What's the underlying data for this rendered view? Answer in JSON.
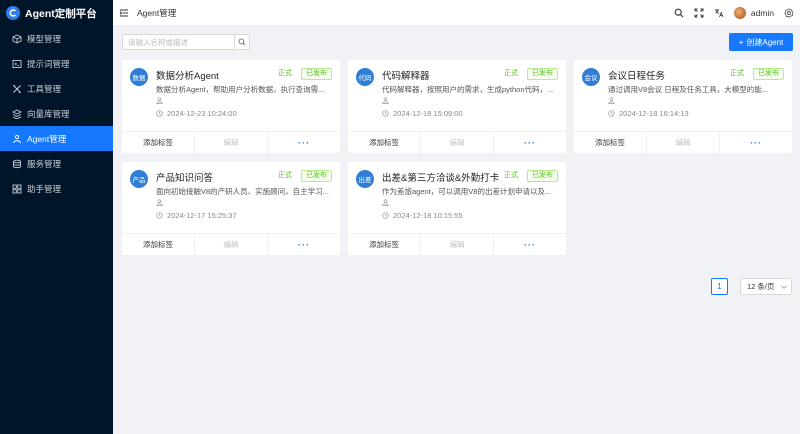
{
  "app": {
    "title": "Agent定制平台"
  },
  "sidebar": {
    "items": [
      {
        "label": "模型管理",
        "icon": "model-icon"
      },
      {
        "label": "提示词管理",
        "icon": "prompt-icon"
      },
      {
        "label": "工具管理",
        "icon": "tools-icon"
      },
      {
        "label": "向量库管理",
        "icon": "vector-icon"
      },
      {
        "label": "Agent管理",
        "icon": "agent-icon",
        "active": true
      },
      {
        "label": "服务管理",
        "icon": "database-icon"
      },
      {
        "label": "助手管理",
        "icon": "grid-icon"
      }
    ]
  },
  "header": {
    "breadcrumb": "Agent管理",
    "user": "admin"
  },
  "toolbar": {
    "search_placeholder": "请输入名称或描述",
    "create_label": "创建Agent"
  },
  "cards": [
    {
      "avatar": "数据",
      "title": "数据分析Agent",
      "tag1": "正式",
      "tag2": "已发布",
      "desc": "数据分析Agent，帮助用户分析数据，执行查询需...",
      "time": "2024-12-23 10:24:00",
      "add_tag": "添加标签",
      "edit": "编辑",
      "more": "···"
    },
    {
      "avatar": "代码",
      "title": "代码解释器",
      "tag1": "正式",
      "tag2": "已发布",
      "desc": "代码解释器，按照用户的需求，生成python代码，...",
      "time": "2024-12-18 15:09:00",
      "add_tag": "添加标签",
      "edit": "编辑",
      "more": "···"
    },
    {
      "avatar": "会议",
      "title": "会议日程任务",
      "tag1": "正式",
      "tag2": "已发布",
      "desc": "通过调用V8会议 日程及任务工具，大模型的能...",
      "time": "2024-12-18 16:14:13",
      "add_tag": "添加标签",
      "edit": "编辑",
      "more": "···"
    },
    {
      "avatar": "产品",
      "title": "产品知识问答",
      "tag1": "正式",
      "tag2": "已发布",
      "desc": "面向初始接触V8的产研人员、实施顾问，自主学习...",
      "time": "2024-12-17 15:25:37",
      "add_tag": "添加标签",
      "edit": "编辑",
      "more": "···"
    },
    {
      "avatar": "出差",
      "title": "出差&第三方洽谈&外勤打卡",
      "tag1": "正式",
      "tag2": "已发布",
      "desc": "作为差旅agent，可以调用V8的出差计划申请以及...",
      "time": "2024-12-18 10:15:55",
      "add_tag": "添加标签",
      "edit": "编辑",
      "more": "···"
    }
  ],
  "pagination": {
    "current": "1",
    "page_size": "12 条/页"
  },
  "colors": {
    "sidebar_bg": "#001529",
    "primary": "#1677ff",
    "success": "#52c41a"
  }
}
